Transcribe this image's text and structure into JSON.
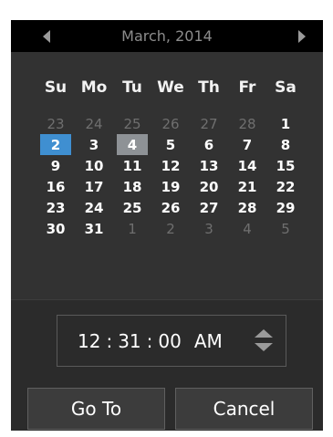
{
  "header": {
    "title": "March, 2014",
    "prev_icon": "triangle-left",
    "next_icon": "triangle-right"
  },
  "weekdays": [
    "Su",
    "Mo",
    "Tu",
    "We",
    "Th",
    "Fr",
    "Sa"
  ],
  "days": [
    {
      "label": "23",
      "state": "other"
    },
    {
      "label": "24",
      "state": "other"
    },
    {
      "label": "25",
      "state": "other"
    },
    {
      "label": "26",
      "state": "other"
    },
    {
      "label": "27",
      "state": "other"
    },
    {
      "label": "28",
      "state": "other"
    },
    {
      "label": "1",
      "state": "current"
    },
    {
      "label": "2",
      "state": "selected"
    },
    {
      "label": "3",
      "state": "current"
    },
    {
      "label": "4",
      "state": "today"
    },
    {
      "label": "5",
      "state": "current"
    },
    {
      "label": "6",
      "state": "current"
    },
    {
      "label": "7",
      "state": "current"
    },
    {
      "label": "8",
      "state": "current"
    },
    {
      "label": "9",
      "state": "current"
    },
    {
      "label": "10",
      "state": "current"
    },
    {
      "label": "11",
      "state": "current"
    },
    {
      "label": "12",
      "state": "current"
    },
    {
      "label": "13",
      "state": "current"
    },
    {
      "label": "14",
      "state": "current"
    },
    {
      "label": "15",
      "state": "current"
    },
    {
      "label": "16",
      "state": "current"
    },
    {
      "label": "17",
      "state": "current"
    },
    {
      "label": "18",
      "state": "current"
    },
    {
      "label": "19",
      "state": "current"
    },
    {
      "label": "20",
      "state": "current"
    },
    {
      "label": "21",
      "state": "current"
    },
    {
      "label": "22",
      "state": "current"
    },
    {
      "label": "23",
      "state": "current"
    },
    {
      "label": "24",
      "state": "current"
    },
    {
      "label": "25",
      "state": "current"
    },
    {
      "label": "26",
      "state": "current"
    },
    {
      "label": "27",
      "state": "current"
    },
    {
      "label": "28",
      "state": "current"
    },
    {
      "label": "29",
      "state": "current"
    },
    {
      "label": "30",
      "state": "current"
    },
    {
      "label": "31",
      "state": "current"
    },
    {
      "label": "1",
      "state": "other"
    },
    {
      "label": "2",
      "state": "other"
    },
    {
      "label": "3",
      "state": "other"
    },
    {
      "label": "4",
      "state": "other"
    },
    {
      "label": "5",
      "state": "other"
    }
  ],
  "time": {
    "hours": "12",
    "minutes": "31",
    "seconds": "00",
    "separator": ":",
    "ampm": "AM",
    "spinner_icon": "up-down-arrows"
  },
  "buttons": {
    "goto_label": "Go To",
    "cancel_label": "Cancel"
  },
  "colors": {
    "selected": "#3f8fd1",
    "today": "#8e9296",
    "background": "#323232",
    "header": "#000000"
  }
}
